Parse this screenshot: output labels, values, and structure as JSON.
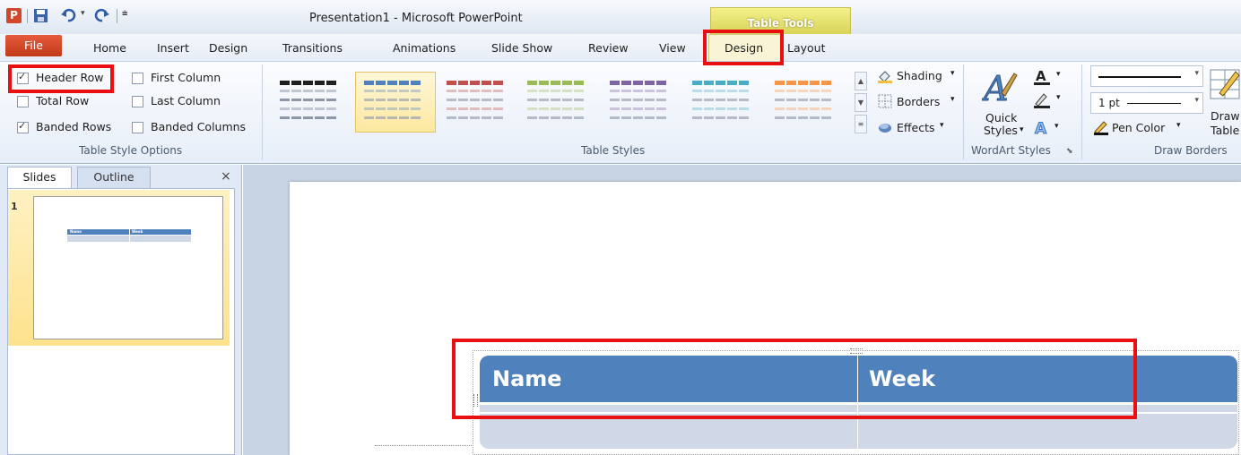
{
  "titlebar": {
    "title": "Presentation1  -  Microsoft PowerPoint",
    "context_tab": "Table Tools",
    "qat": [
      "save-icon",
      "undo-icon",
      "redo-icon",
      "customize-icon"
    ]
  },
  "tabs": [
    "File",
    "Home",
    "Insert",
    "Design",
    "Transitions",
    "Animations",
    "Slide Show",
    "Review",
    "View",
    "Design",
    "Layout"
  ],
  "table_style_options": {
    "group_label": "Table Style Options",
    "options": [
      {
        "label": "Header Row",
        "checked": true
      },
      {
        "label": "Total Row",
        "checked": false
      },
      {
        "label": "Banded Rows",
        "checked": true
      },
      {
        "label": "First Column",
        "checked": false
      },
      {
        "label": "Last Column",
        "checked": false
      },
      {
        "label": "Banded Columns",
        "checked": false
      }
    ]
  },
  "table_styles": {
    "group_label": "Table Styles",
    "colors": [
      "#1f1f1f",
      "#4f81bd",
      "#c0504d",
      "#9bbb59",
      "#8064a2",
      "#4bacc6",
      "#f79646"
    ],
    "shading": "Shading",
    "borders": "Borders",
    "effects": "Effects"
  },
  "wordart": {
    "group_label": "WordArt Styles",
    "quick_styles_line1": "Quick",
    "quick_styles_line2": "Styles"
  },
  "draw_borders": {
    "group_label": "Draw Borders",
    "pen_weight": "1 pt",
    "pen_color": "Pen Color",
    "draw_table_line1": "Draw",
    "draw_table_line2": "Table"
  },
  "panel": {
    "tab_slides": "Slides",
    "tab_outline": "Outline",
    "close": "×",
    "slide_number": "1",
    "thumb_name": "Name",
    "thumb_week": "Week"
  },
  "table": {
    "headers": [
      "Name",
      "Week"
    ]
  }
}
